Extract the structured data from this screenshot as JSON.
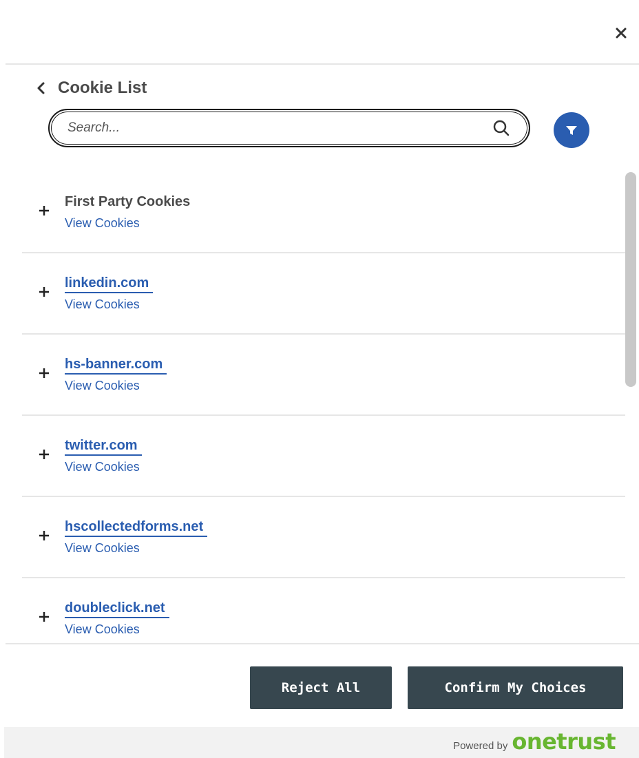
{
  "header": {
    "title": "Cookie List"
  },
  "search": {
    "placeholder": "Search..."
  },
  "list": {
    "items": [
      {
        "title": "First Party Cookies",
        "view_label": "View Cookies"
      },
      {
        "title": "linkedin.com",
        "view_label": "View Cookies"
      },
      {
        "title": "hs-banner.com",
        "view_label": "View Cookies"
      },
      {
        "title": "twitter.com",
        "view_label": "View Cookies"
      },
      {
        "title": "hscollectedforms.net",
        "view_label": "View Cookies"
      },
      {
        "title": "doubleclick.net",
        "view_label": "View Cookies"
      }
    ]
  },
  "buttons": {
    "reject_all": "Reject All",
    "confirm": "Confirm My Choices"
  },
  "footer": {
    "powered_by": "Powered by",
    "brand": "onetrust"
  },
  "icons": {
    "close": "close-icon",
    "back": "chevron-left-icon",
    "search": "search-icon",
    "filter": "filter-icon",
    "expand": "plus-icon"
  },
  "colors": {
    "link": "#2a5db0",
    "button": "#37474f",
    "brand": "#68b631"
  }
}
